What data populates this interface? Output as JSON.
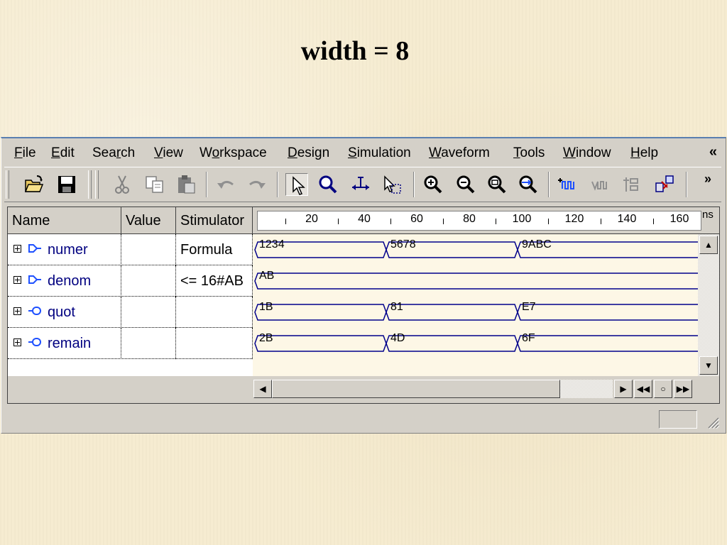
{
  "slide": {
    "title": "width = 8"
  },
  "menu": {
    "items": [
      {
        "pre": "",
        "ul": "F",
        "post": "ile"
      },
      {
        "pre": "",
        "ul": "E",
        "post": "dit"
      },
      {
        "pre": "Sea",
        "ul": "r",
        "post": "ch"
      },
      {
        "pre": "",
        "ul": "V",
        "post": "iew"
      },
      {
        "pre": "W",
        "ul": "o",
        "post": "rkspace"
      },
      {
        "pre": "",
        "ul": "D",
        "post": "esign"
      },
      {
        "pre": "",
        "ul": "S",
        "post": "imulation"
      },
      {
        "pre": "",
        "ul": "W",
        "post": "aveform"
      },
      {
        "pre": "",
        "ul": "T",
        "post": "ools"
      },
      {
        "pre": "",
        "ul": "W",
        "post": "indow"
      },
      {
        "pre": "",
        "ul": "H",
        "post": "elp"
      }
    ],
    "chevron": "«"
  },
  "toolbar": {
    "more": "»",
    "buttons": [
      "open-icon",
      "save-icon",
      "cut-icon",
      "copy-icon",
      "paste-icon",
      "undo-icon",
      "redo-icon",
      "select-pointer-icon",
      "zoom-tool-icon",
      "measure-icon",
      "cursor-select-icon",
      "zoom-in-icon",
      "zoom-out-icon",
      "zoom-fit-icon",
      "zoom-full-icon",
      "add-signal-icon",
      "remove-signal-icon",
      "bus-icon",
      "hierarchy-icon"
    ]
  },
  "table": {
    "headers": {
      "name": "Name",
      "value": "Value",
      "stimulator": "Stimulator"
    },
    "rows": [
      {
        "name": "numer",
        "value": "",
        "stimulator": "Formula",
        "kind": "input"
      },
      {
        "name": "denom",
        "value": "",
        "stimulator": "<= 16#AB",
        "kind": "input"
      },
      {
        "name": "quot",
        "value": "",
        "stimulator": "",
        "kind": "output"
      },
      {
        "name": "remain",
        "value": "",
        "stimulator": "",
        "kind": "output"
      }
    ]
  },
  "ruler": {
    "unit": "ns",
    "labels": [
      "20",
      "40",
      "60",
      "80",
      "100",
      "120",
      "140",
      "160"
    ]
  },
  "waves": [
    {
      "segments": [
        {
          "t": 0,
          "v": "1234"
        },
        {
          "t": 50,
          "v": "5678"
        },
        {
          "t": 100,
          "v": "9ABC"
        }
      ]
    },
    {
      "segments": [
        {
          "t": 0,
          "v": "AB"
        }
      ]
    },
    {
      "segments": [
        {
          "t": 0,
          "v": "1B"
        },
        {
          "t": 50,
          "v": "81"
        },
        {
          "t": 100,
          "v": "E7"
        }
      ]
    },
    {
      "segments": [
        {
          "t": 0,
          "v": "2B"
        },
        {
          "t": 50,
          "v": "4D"
        },
        {
          "t": 100,
          "v": "6F"
        }
      ]
    }
  ],
  "colors": {
    "wave_line": "#00008b",
    "signal_name": "#000080",
    "icon_blue": "#1e50ff"
  }
}
